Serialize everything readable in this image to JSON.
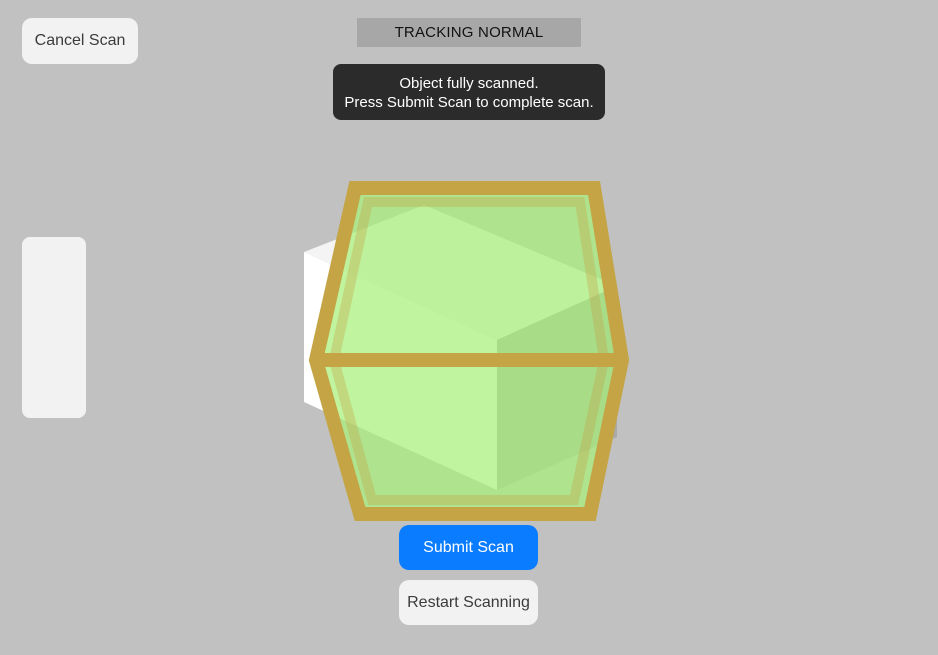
{
  "header": {
    "cancel_label": "Cancel Scan",
    "tracking_status": "TRACKING NORMAL"
  },
  "toast": {
    "line1": "Object fully scanned.",
    "line2": "Press Submit Scan to complete scan."
  },
  "actions": {
    "submit_label": "Submit Scan",
    "restart_label": "Restart Scanning"
  },
  "colors": {
    "background": "#c1c1c1",
    "bounding_box_frame": "#c4a444",
    "scan_fill": "#a8f07a",
    "primary": "#0a7cff"
  }
}
